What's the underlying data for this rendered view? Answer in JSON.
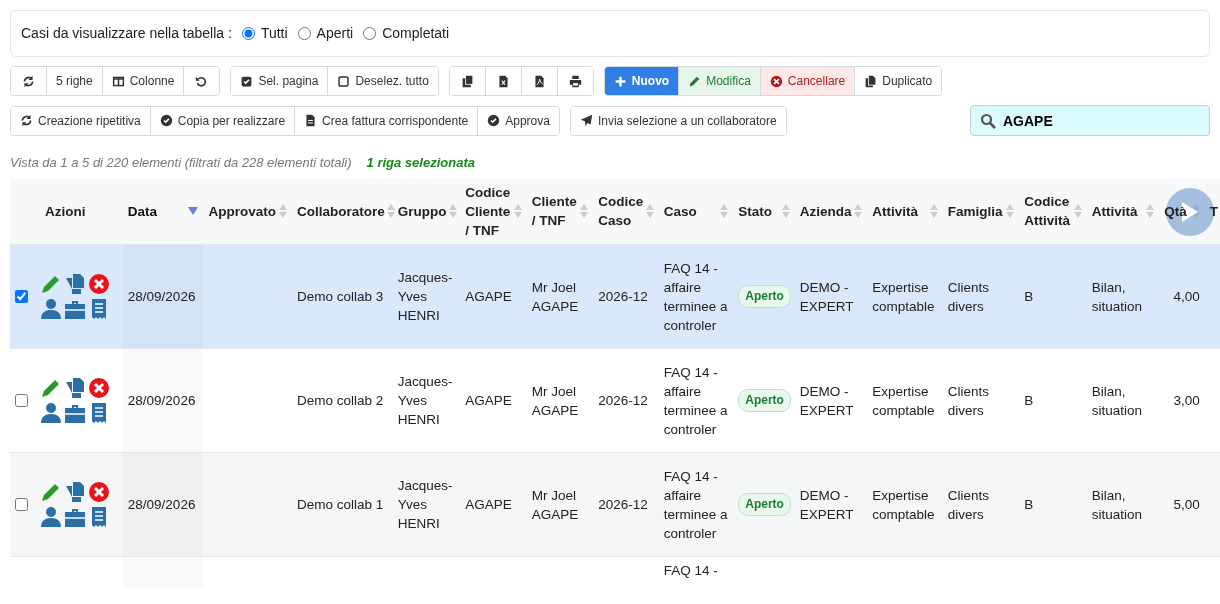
{
  "filter": {
    "label": "Casi da visualizzare nella tabella :",
    "options": [
      {
        "label": "Tutti",
        "selected": true
      },
      {
        "label": "Aperti",
        "selected": false
      },
      {
        "label": "Completati",
        "selected": false
      }
    ]
  },
  "toolbar": [
    [
      {
        "kind": "icon"
      },
      {
        "kind": "text",
        "label": "5 righe"
      },
      {
        "kind": "text",
        "label": "Colonne"
      },
      {
        "kind": "icon"
      }
    ],
    [
      {
        "kind": "text",
        "label": "Sel. pagina"
      },
      {
        "kind": "text",
        "label": "Deselez. tutto"
      }
    ],
    [
      {
        "kind": "icon"
      },
      {
        "kind": "icon"
      },
      {
        "kind": "icon"
      },
      {
        "kind": "icon"
      }
    ],
    [
      {
        "kind": "text",
        "label": "Nuovo"
      },
      {
        "kind": "text",
        "label": "Modifica"
      },
      {
        "kind": "text",
        "label": "Cancellare"
      },
      {
        "kind": "text",
        "label": "Duplicato"
      }
    ]
  ],
  "toolbar_2": [
    [
      {
        "kind": "text",
        "label": "Creazione ripetitiva"
      },
      {
        "kind": "text",
        "label": "Copia per realizzare"
      },
      {
        "kind": "text",
        "label": "Crea fattura corrispondente"
      },
      {
        "kind": "text",
        "label": "Approva"
      }
    ],
    [
      {
        "kind": "text",
        "label": "Invia selezione a un collaboratore"
      }
    ]
  ],
  "search": {
    "value": "AGAPE"
  },
  "summary": "Vista da 1 a 5 di 220 elementi (filtrati da 228 elementi totali)",
  "selection_info": "1 riga selezionata",
  "table": {
    "columns": [
      {
        "label": "Azioni"
      },
      {
        "label": "Data",
        "sorted": true
      },
      {
        "label": "Approvato",
        "sortable": true,
        "sorted": false
      },
      {
        "label": "Collaboratore",
        "sortable": true,
        "sorted": false
      },
      {
        "label": "Gruppo",
        "sortable": true,
        "sorted": false
      },
      {
        "label": "Codice Cliente / TNF",
        "sortable": true,
        "sorted": false
      },
      {
        "label": "Cliente / TNF",
        "sortable": true,
        "sorted": false
      },
      {
        "label": "Codice Caso",
        "sortable": true,
        "sorted": false
      },
      {
        "label": "Caso",
        "sortable": true,
        "sorted": false
      },
      {
        "label": "Stato",
        "sortable": true,
        "sorted": false
      },
      {
        "label": "Azienda",
        "sortable": true,
        "sorted": false
      },
      {
        "label": "Attività",
        "sortable": true,
        "sorted": false
      },
      {
        "label": "Famiglia",
        "sortable": true,
        "sorted": false
      },
      {
        "label": "Codice Attività",
        "sortable": true,
        "sorted": false
      },
      {
        "label": "Attività",
        "sortable": true,
        "sorted": false
      },
      {
        "label": "Qtà",
        "sortable": true,
        "sorted": false
      },
      {
        "label": "T"
      }
    ],
    "rows": [
      {
        "selected": true,
        "cut": false,
        "cells": [
          "",
          "28/09/2026",
          "",
          "Demo collab 3",
          "Jacques-Yves HENRI",
          "AGAPE",
          "Mr Joel AGAPE",
          "2026-12",
          "FAQ 14 - affaire terminee a controler",
          "Aperto",
          "DEMO - EXPERT",
          "Expertise comptable",
          "Clients divers",
          "B",
          "Bilan, situation",
          "4,00"
        ]
      },
      {
        "selected": false,
        "cut": false,
        "cells": [
          "",
          "28/09/2026",
          "",
          "Demo collab 2",
          "Jacques-Yves HENRI",
          "AGAPE",
          "Mr Joel AGAPE",
          "2026-12",
          "FAQ 14 - affaire terminee a controler",
          "Aperto",
          "DEMO - EXPERT",
          "Expertise comptable",
          "Clients divers",
          "B",
          "Bilan, situation",
          "3,00"
        ]
      },
      {
        "selected": false,
        "cut": false,
        "cells": [
          "",
          "28/09/2026",
          "",
          "Demo collab 1",
          "Jacques-Yves HENRI",
          "AGAPE",
          "Mr Joel AGAPE",
          "2026-12",
          "FAQ 14 - affaire terminee a controler",
          "Aperto",
          "DEMO - EXPERT",
          "Expertise comptable",
          "Clients divers",
          "B",
          "Bilan, situation",
          "5,00"
        ]
      },
      {
        "selected": false,
        "cut": true,
        "cells": [
          "",
          "",
          "",
          "",
          "",
          "",
          "",
          "",
          "FAQ 14 -",
          "",
          "",
          "",
          "",
          "",
          "",
          ""
        ]
      }
    ]
  }
}
